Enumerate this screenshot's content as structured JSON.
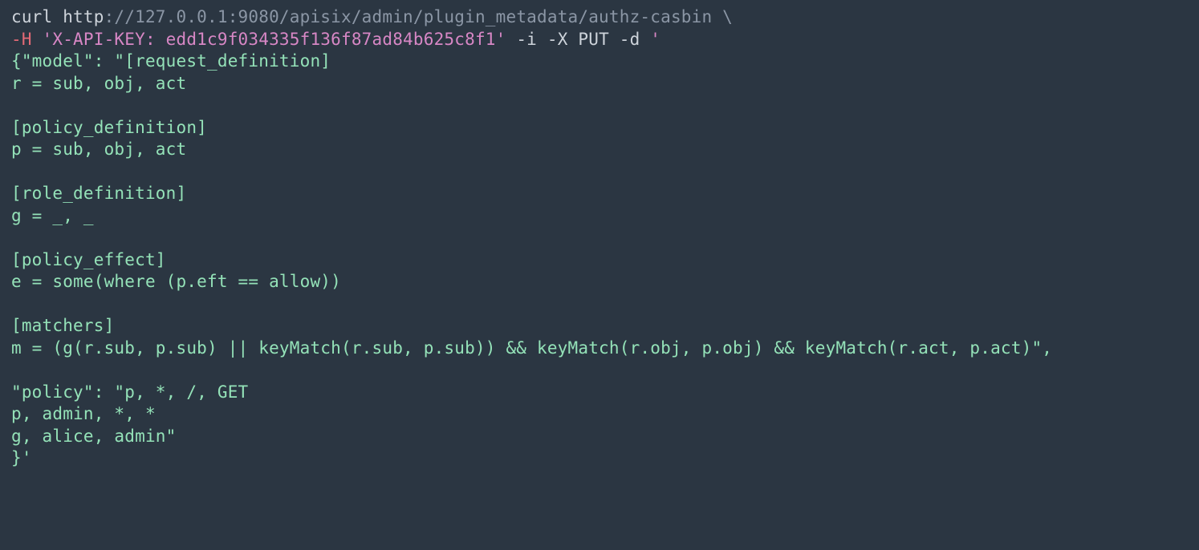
{
  "code": {
    "l1_curl": "curl ",
    "l1_http": "http",
    "l1_url": "://127.0.0.1:9080/apisix/admin/plugin_metadata/authz-casbin \\",
    "l2_flagH": "-H ",
    "l2_q1": "'",
    "l2_key": "X-API-KEY: edd1c9f034335f136f87ad84b625c8f1",
    "l2_q2": "'",
    "l2_rest": " -i -X ",
    "l2_put": "PUT",
    "l2_d": " -d ",
    "l2_q3": "'",
    "l3": "{\"model\": \"[request_definition]",
    "l4": "r = sub, obj, act",
    "l5": "",
    "l6": "[policy_definition]",
    "l7": "p = sub, obj, act",
    "l8": "",
    "l9": "[role_definition]",
    "l10": "g = _, _",
    "l11": "",
    "l12": "[policy_effect]",
    "l13": "e = some(where (p.eft == allow))",
    "l14": "",
    "l15": "[matchers]",
    "l16": "m = (g(r.sub, p.sub) || keyMatch(r.sub, p.sub)) && keyMatch(r.obj, p.obj) && keyMatch(r.act, p.act)\",",
    "l17": "",
    "l18": "\"policy\": \"p, *, /, GET",
    "l19": "p, admin, *, *",
    "l20": "g, alice, admin\"",
    "l21": "}'"
  }
}
